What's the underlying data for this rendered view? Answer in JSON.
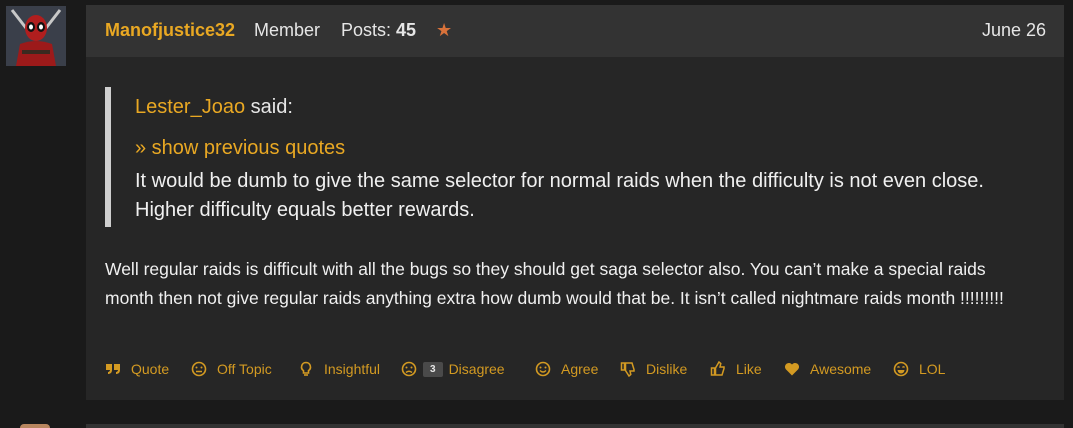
{
  "post": {
    "username": "Manofjustice32",
    "role": "Member",
    "posts_label": "Posts:",
    "posts_count": "45",
    "star": "★",
    "date": "June 26",
    "quote": {
      "author": "Lester_Joao",
      "said": " said:",
      "show_previous": "» show previous quotes",
      "text": "It would be dumb to give the same selector for normal raids when the difficulty is not even close. Higher difficulty equals better rewards."
    },
    "body": "Well regular raids is difficult with all the bugs so they should get saga selector also. You can’t make a special raids month then not give regular raids anything extra how dumb would that be. It isn’t called nightmare raids month !!!!!!!!!",
    "reactions": [
      {
        "label": "Quote",
        "icon": "quote-icon"
      },
      {
        "label": "Off Topic",
        "icon": "off-topic-face-icon"
      },
      {
        "label": "Insightful",
        "icon": "lightbulb-icon"
      },
      {
        "label": "Disagree",
        "icon": "frown-face-icon",
        "count": "3"
      },
      {
        "label": "Agree",
        "icon": "smile-face-icon"
      },
      {
        "label": "Dislike",
        "icon": "thumbs-down-icon"
      },
      {
        "label": "Like",
        "icon": "thumbs-up-icon"
      },
      {
        "label": "Awesome",
        "icon": "heart-icon"
      },
      {
        "label": "LOL",
        "icon": "laughing-face-icon"
      }
    ]
  },
  "colors": {
    "accent": "#e9a823",
    "reaction": "#d39a22",
    "header_bg": "#333333",
    "post_bg": "#262626",
    "page_bg": "#1a1a1a"
  }
}
